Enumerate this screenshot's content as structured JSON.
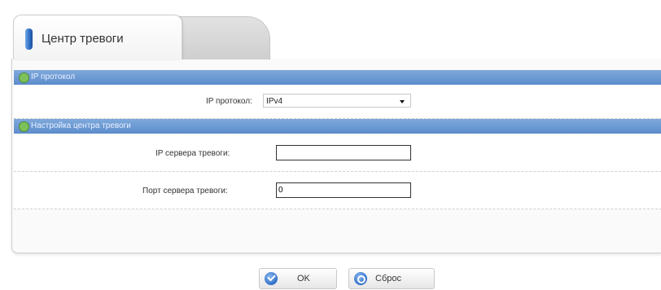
{
  "tab": {
    "active_label": "Центр тревоги",
    "inactive_label": ""
  },
  "sections": {
    "ip_protocol": {
      "title": "IP протокол",
      "field_label": "IP протокол:",
      "selected_value": "IPv4"
    },
    "alarm_center": {
      "title": "Настройка центра тревоги",
      "server_ip_label": "IP сервера тревоги:",
      "server_ip_value": "",
      "server_port_label": "Порт сервера тревоги:",
      "server_port_value": "0"
    }
  },
  "buttons": {
    "ok_label": "OK",
    "reset_label": "Сброс"
  },
  "colors": {
    "section_bar": "#6a98d2",
    "tab_marker": "#2d6cc4",
    "status_dot": "#7cc15a"
  }
}
